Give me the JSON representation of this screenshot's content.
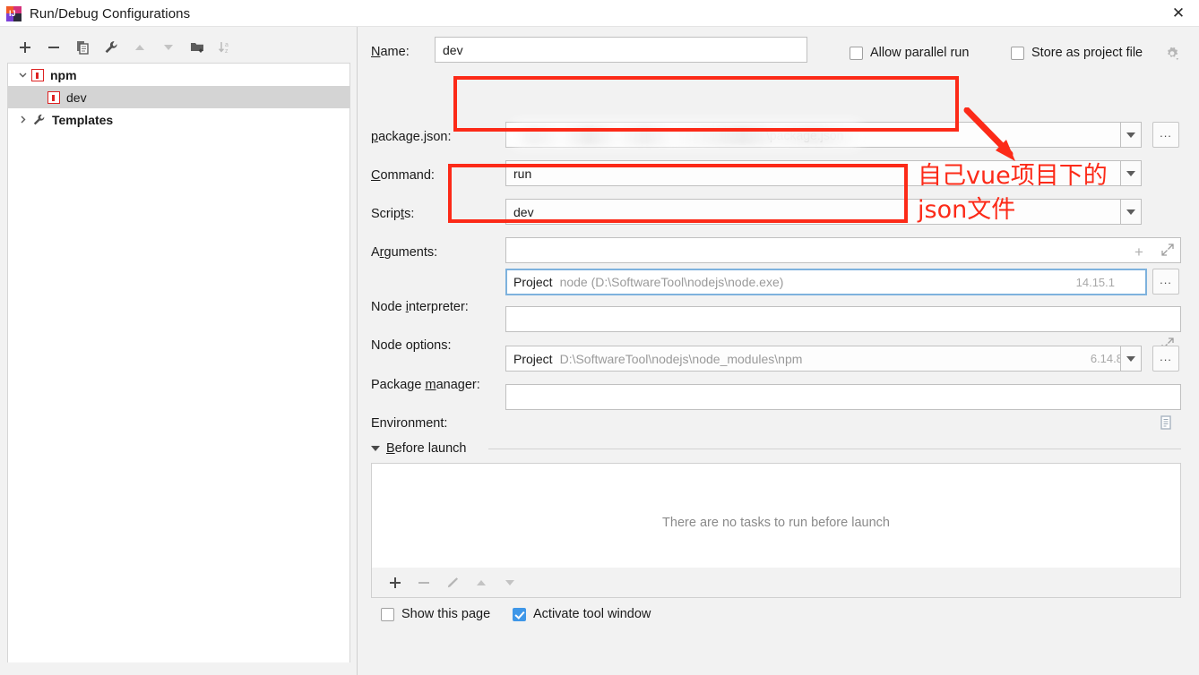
{
  "window": {
    "title": "Run/Debug Configurations",
    "app_icon": "intellij-idea-icon",
    "close_label": "✕"
  },
  "sidebar": {
    "toolbar": [
      {
        "name": "add-configuration-button",
        "icon": "plus-icon",
        "label": "+"
      },
      {
        "name": "remove-configuration-button",
        "icon": "minus-icon",
        "label": "−"
      },
      {
        "name": "copy-configuration-button",
        "icon": "copy-icon",
        "label": "Copy"
      },
      {
        "name": "edit-templates-button",
        "icon": "wrench-icon",
        "label": "Edit Templates"
      },
      {
        "name": "move-up-button",
        "icon": "arrow-up-icon",
        "label": "Move Up"
      },
      {
        "name": "move-down-button",
        "icon": "arrow-down-icon",
        "label": "Move Down"
      },
      {
        "name": "new-folder-button",
        "icon": "folder-add-icon",
        "label": "New Folder"
      },
      {
        "name": "sort-button",
        "icon": "sort-az-icon",
        "label": "Sort Configurations"
      }
    ],
    "tree": [
      {
        "label": "npm",
        "icon": "npm-icon",
        "level": 0,
        "expanded": true,
        "selected": false,
        "bold": true
      },
      {
        "label": "dev",
        "icon": "npm-icon",
        "level": 1,
        "expanded": null,
        "selected": true,
        "bold": false
      },
      {
        "label": "Templates",
        "icon": "wrench-icon",
        "level": 0,
        "expanded": false,
        "selected": false,
        "bold": true
      }
    ]
  },
  "form": {
    "name": {
      "label": "Name:",
      "label_mnemonic": "N",
      "value": "dev"
    },
    "allow_parallel_run": {
      "label": "Allow parallel run",
      "checked": false
    },
    "store_as_project_file": {
      "label": "Store as project file",
      "checked": false,
      "gear_icon": "gear-icon"
    },
    "package_json": {
      "label": "package.json:",
      "value": "\\package.json",
      "value_prefix_blurred": true,
      "dropdown_icon": "chevron-down-icon",
      "browse_label": "..."
    },
    "command": {
      "label": "Command:",
      "value": "run",
      "dropdown_icon": "chevron-down-icon"
    },
    "scripts": {
      "label": "Scripts:",
      "value": "dev",
      "dropdown_icon": "chevron-down-icon"
    },
    "arguments": {
      "label": "Arguments:",
      "value": "",
      "add_icon": "plus-icon",
      "expand_icon": "expand-icon"
    },
    "node_interpreter": {
      "label": "Node interpreter:",
      "scope": "Project",
      "value": "node (D:\\SoftwareTool\\nodejs\\node.exe)",
      "version": "14.15.1",
      "dropdown_icon": "chevron-down-icon",
      "browse_label": "...",
      "focused": true
    },
    "node_options": {
      "label": "Node options:",
      "value": "",
      "expand_icon": "expand-icon"
    },
    "package_manager": {
      "label": "Package manager:",
      "scope": "Project",
      "value": "D:\\SoftwareTool\\nodejs\\node_modules\\npm",
      "version": "6.14.8",
      "dropdown_icon": "chevron-down-icon",
      "browse_label": "..."
    },
    "environment": {
      "label": "Environment:",
      "value": "",
      "editor_icon": "list-editor-icon"
    },
    "before_launch": {
      "title": "Before launch",
      "expanded": true,
      "empty_text": "There are no tasks to run before launch",
      "toolbar": [
        {
          "name": "add-task-button",
          "icon": "plus-icon"
        },
        {
          "name": "remove-task-button",
          "icon": "minus-icon"
        },
        {
          "name": "edit-task-button",
          "icon": "pencil-icon"
        },
        {
          "name": "move-task-up-button",
          "icon": "arrow-up-icon"
        },
        {
          "name": "move-task-down-button",
          "icon": "arrow-down-icon"
        }
      ]
    },
    "show_this_page": {
      "label": "Show this page",
      "checked": false
    },
    "activate_tool_window": {
      "label": "Activate tool window",
      "checked": true
    }
  },
  "annotations": {
    "note_line1": "自己vue项目下的",
    "note_line2": "json文件",
    "color": "#fc2a18"
  }
}
